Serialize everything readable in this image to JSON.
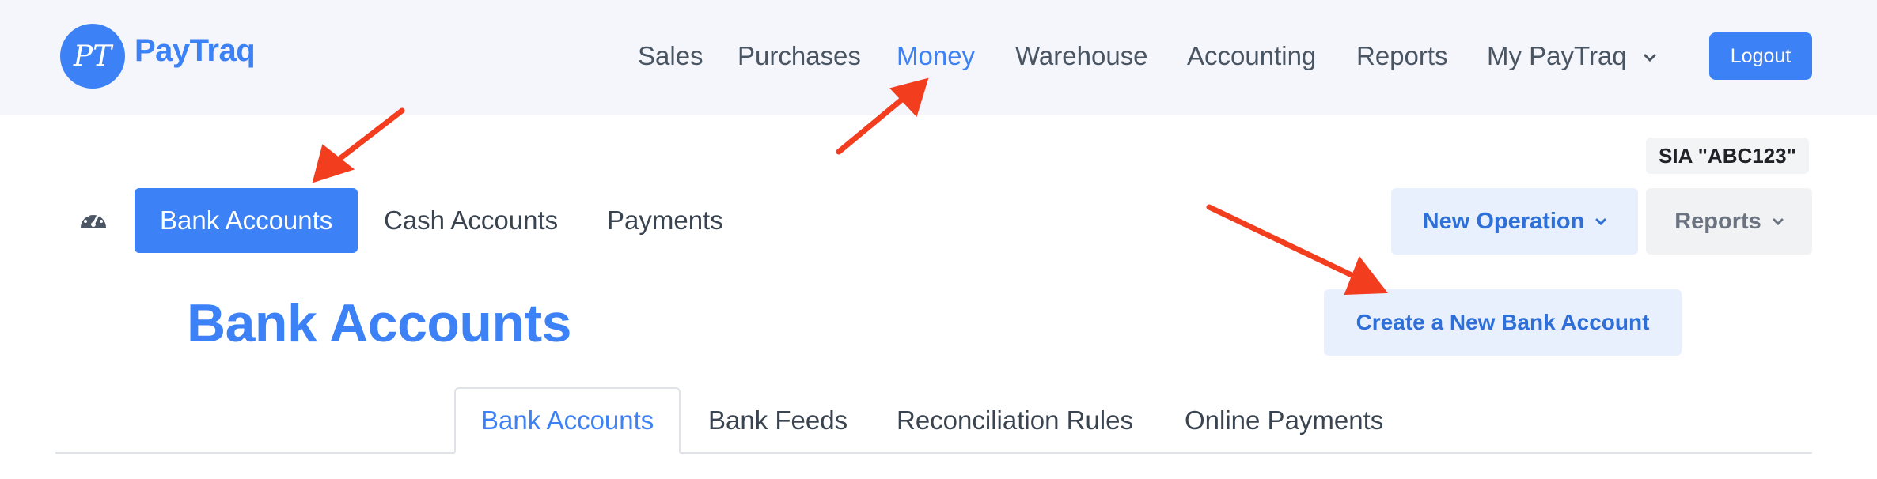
{
  "app": {
    "name": "PayTraq",
    "logo_monogram": "PT",
    "brand_color": "#3c82f6",
    "accent_arrow_color": "#f23d1f"
  },
  "topnav": {
    "items": [
      {
        "label": "Sales"
      },
      {
        "label": "Purchases"
      },
      {
        "label": "Money",
        "active": true
      },
      {
        "label": "Warehouse"
      },
      {
        "label": "Accounting"
      },
      {
        "label": "Reports"
      },
      {
        "label": "My PayTraq",
        "has_dropdown": true
      }
    ],
    "logout_label": "Logout"
  },
  "company_name": "SIA \"ABC123\"",
  "subnav": {
    "dashboard_icon": "speedometer-icon",
    "items": [
      {
        "label": "Bank Accounts",
        "active": true
      },
      {
        "label": "Cash Accounts"
      },
      {
        "label": "Payments"
      }
    ],
    "new_operation_label": "New Operation",
    "reports_label": "Reports"
  },
  "page": {
    "title": "Bank Accounts",
    "create_button_label": "Create a New Bank Account"
  },
  "tabs": [
    {
      "label": "Bank Accounts",
      "active": true
    },
    {
      "label": "Bank Feeds"
    },
    {
      "label": "Reconciliation Rules"
    },
    {
      "label": "Online Payments"
    }
  ]
}
